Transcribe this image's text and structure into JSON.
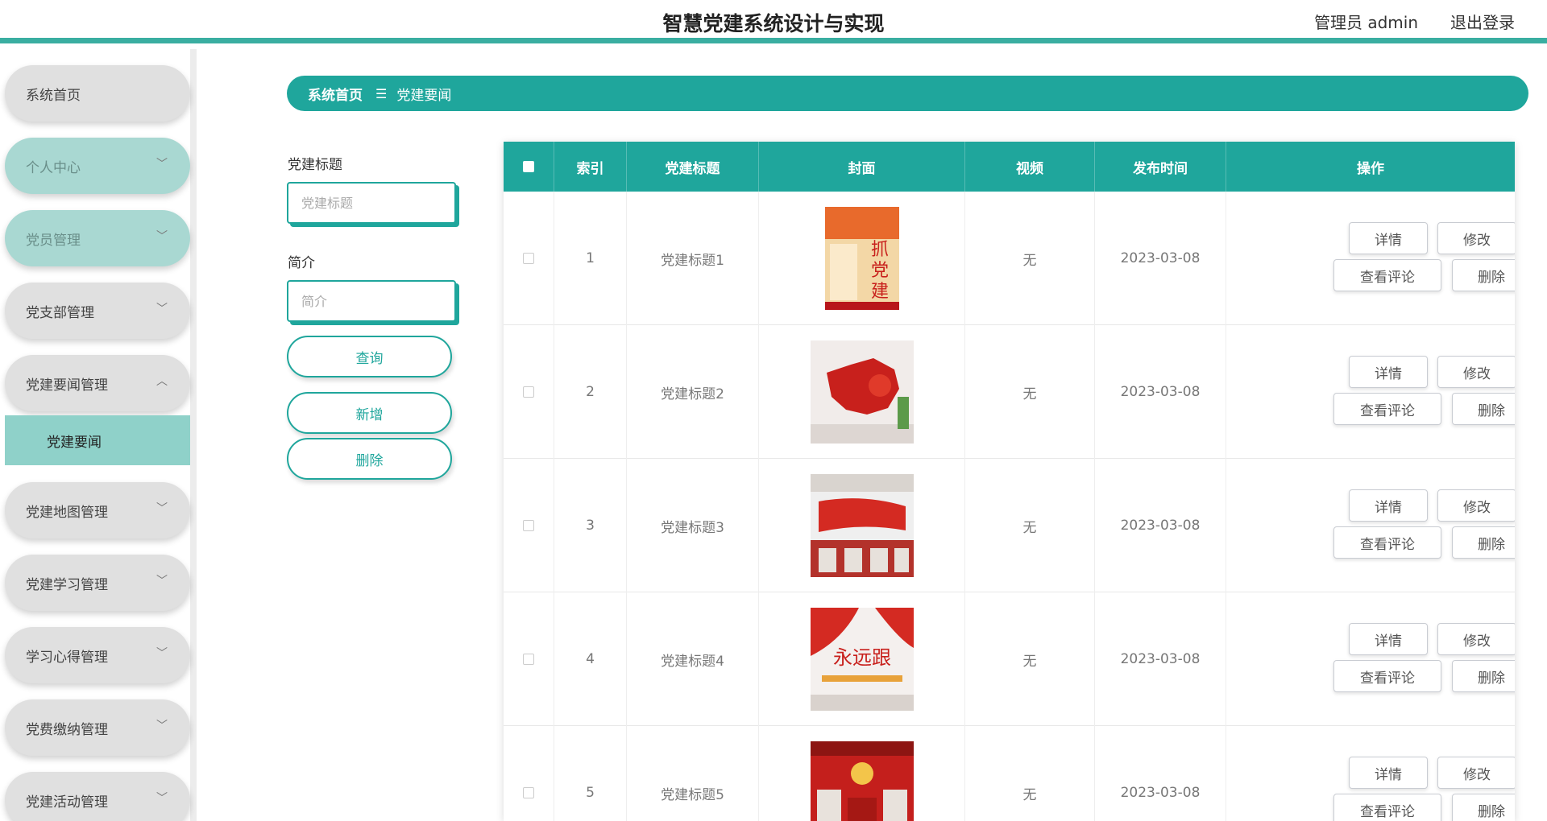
{
  "header": {
    "title": "智慧党建系统设计与实现",
    "user_label": "管理员 admin",
    "logout_label": "退出登录"
  },
  "sidebar": {
    "items": [
      {
        "label": "系统首页"
      },
      {
        "label": "个人中心"
      },
      {
        "label": "党员管理"
      },
      {
        "label": "党支部管理"
      },
      {
        "label": "党建要闻管理"
      },
      {
        "label": "党建地图管理"
      },
      {
        "label": "党建学习管理"
      },
      {
        "label": "学习心得管理"
      },
      {
        "label": "党费缴纳管理"
      },
      {
        "label": "党建活动管理"
      }
    ],
    "active_sub": "党建要闻"
  },
  "breadcrumb": {
    "home": "系统首页",
    "separator": "☰",
    "current": "党建要闻"
  },
  "search": {
    "title_label": "党建标题",
    "title_placeholder": "党建标题",
    "intro_label": "简介",
    "intro_placeholder": "简介",
    "query_btn": "查询",
    "add_btn": "新增",
    "delete_btn": "删除"
  },
  "table": {
    "headers": [
      "索引",
      "党建标题",
      "封面",
      "视频",
      "发布时间",
      "操作"
    ],
    "rows": [
      {
        "index": "1",
        "title": "党建标题1",
        "video": "无",
        "date": "2023-03-08"
      },
      {
        "index": "2",
        "title": "党建标题2",
        "video": "无",
        "date": "2023-03-08"
      },
      {
        "index": "3",
        "title": "党建标题3",
        "video": "无",
        "date": "2023-03-08"
      },
      {
        "index": "4",
        "title": "党建标题4",
        "video": "无",
        "date": "2023-03-08"
      },
      {
        "index": "5",
        "title": "党建标题5",
        "video": "无",
        "date": "2023-03-08"
      }
    ],
    "actions": {
      "detail": "详情",
      "edit": "修改",
      "comments": "查看评论",
      "delete": "删除"
    }
  },
  "colors": {
    "accent": "#1fa69c",
    "menu_grey": "#e0e0e0",
    "menu_teal": "#a9d8d2",
    "poster_red": "#c8201c"
  }
}
